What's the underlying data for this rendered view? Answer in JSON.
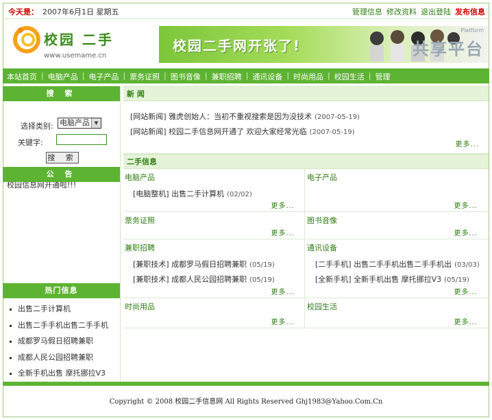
{
  "topbar": {
    "date_label": "今天是：",
    "date_text": "2007年6月1日  星期五",
    "links": [
      "管理信息",
      "修改资料",
      "退出登陆"
    ],
    "publish": "发布信息"
  },
  "header": {
    "logo_title": "校园 二手",
    "logo_url": "www.usemame.cn",
    "banner_text": "校园二手网开张了!",
    "watermark": "共享平台",
    "watermark_small": "Platform"
  },
  "nav": {
    "items": [
      "本站首页",
      "电脑产品",
      "电子产品",
      "票务证照",
      "图书音像",
      "兼职招聘",
      "通讯设备",
      "时尚用品",
      "校园生活",
      "管理"
    ]
  },
  "sidebar": {
    "search_title": "搜 索",
    "category_label": "选择类别:",
    "category_value": "电脑产品",
    "keyword_label": "关键字:",
    "search_button": "搜 索",
    "notice_title": "公 告",
    "notice_text": "校园信息网开通啦!!!",
    "hot_title": "热门信息",
    "hot_items": [
      "出售二手计算机",
      "出售二手手机出售二手手机",
      "成都罗马假日招聘兼职",
      "成都人民公园招聘兼职",
      "全新手机出售 摩托挪拉V3"
    ]
  },
  "news": {
    "title": "新 闻",
    "items": [
      {
        "text": "[网站新闻] 雅虎创始人：当初不重视搜索是因为没技术",
        "date": "(2007-05-19)"
      },
      {
        "text": "[网站新闻] 校园二手信息网开通了 欢迎大家经常光临",
        "date": "(2007-05-19)"
      }
    ],
    "more": "更多..."
  },
  "secondhand": {
    "title": "二手信息",
    "more": "更多...",
    "cells": [
      {
        "title": "电脑产品",
        "rows": [
          {
            "text": "[电脑整机] 出售二手计算机",
            "date": "(02/02)"
          }
        ]
      },
      {
        "title": "电子产品",
        "rows": []
      },
      {
        "title": "票务证照",
        "rows": []
      },
      {
        "title": "图书音像",
        "rows": []
      },
      {
        "title": "兼职招聘",
        "rows": [
          {
            "text": "[兼职技术] 成都罗马假日招聘兼职",
            "date": "(05/19)"
          },
          {
            "text": "[兼职技术] 成都人民公园招聘兼职",
            "date": "(05/19)"
          }
        ]
      },
      {
        "title": "通讯设备",
        "rows": [
          {
            "text": "[二手手机] 出售二手手机出售二手手机出",
            "date": "(03/03)"
          },
          {
            "text": "[全新手机] 全新手机出售 摩托挪拉V3",
            "date": "(05/19)"
          }
        ]
      },
      {
        "title": "时尚用品",
        "rows": []
      },
      {
        "title": "校园生活",
        "rows": []
      }
    ]
  },
  "footer": {
    "text": "Copyright © 2008 校园二手信息网 All Rights Reserved Ghj1983@Yahoo.Com.Cn"
  },
  "colors": {
    "accent": "#5db332",
    "title_green": "#2f7d12",
    "alert_red": "#cc0000"
  }
}
